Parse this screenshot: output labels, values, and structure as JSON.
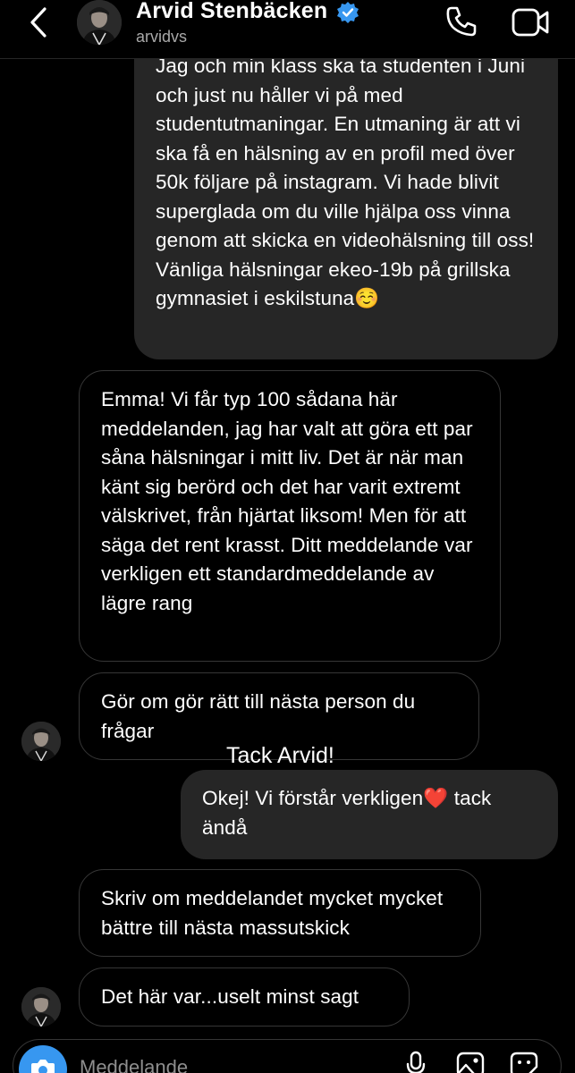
{
  "header": {
    "name": "Arvid Stenbäcken",
    "handle": "arvidvs",
    "icons": [
      "back-chevron-icon",
      "verified-badge-icon",
      "phone-icon",
      "video-camera-icon"
    ]
  },
  "messages": [
    {
      "side": "sent",
      "text": "Jag och min klass ska ta studenten i Juni och just nu håller vi på med studentutmaningar. En utmaning är att vi ska få en hälsning av en profil med över 50k följare på instagram. Vi hade blivit superglada om du ville hjälpa oss vinna genom att skicka en videohälsning till oss! Vänliga hälsningar ekeo-19b på grillska gymnasiet i eskilstuna☺️"
    },
    {
      "side": "received",
      "text": "Emma! Vi får typ 100 sådana här meddelanden, jag har valt att göra ett par såna hälsningar i mitt liv. Det är när man känt sig berörd och det har varit extremt välskrivet, från hjärtat liksom! Men för att säga det rent krasst. Ditt meddelande var verkligen ett standardmeddelande av lägre rang"
    },
    {
      "side": "received",
      "text": "Gör om gör rätt till nästa person du frågar"
    },
    {
      "side": "sent",
      "text": "Okej! Vi förstår verkligen❤️ tack ändå"
    },
    {
      "side": "received",
      "text": "Skriv om meddelandet mycket mycket bättre till nästa massutskick"
    },
    {
      "side": "received",
      "text": "Det här var...uselt minst sagt"
    }
  ],
  "overlay_caption": "Tack Arvid!",
  "composer": {
    "placeholder": "Meddelande",
    "icons": [
      "camera-icon",
      "microphone-icon",
      "gallery-icon",
      "sticker-icon"
    ]
  },
  "colors": {
    "background": "#000000",
    "sent_bubble": "#262626",
    "received_border": "#363636",
    "verified": "#3797f0",
    "camera_button": "#3797f0",
    "heart": "#e0245e"
  }
}
